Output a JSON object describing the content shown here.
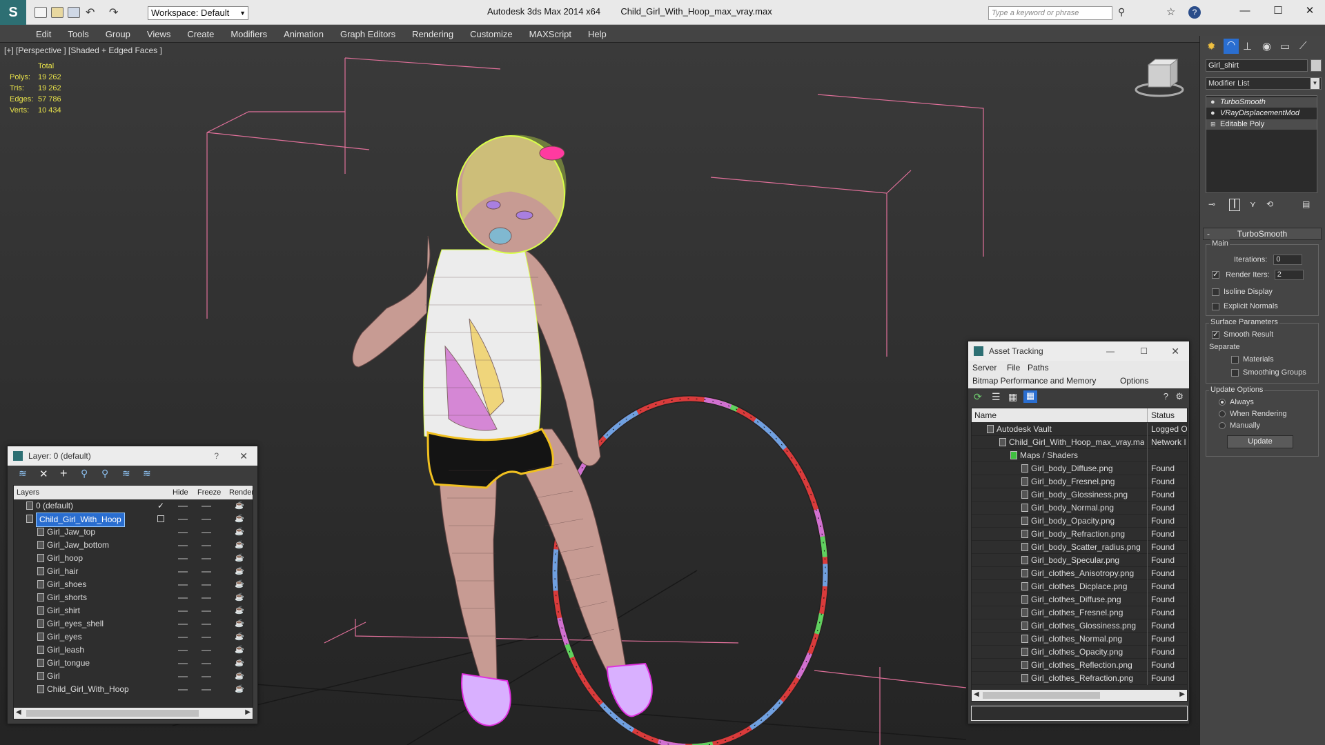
{
  "titlebar": {
    "app_title": "Autodesk 3ds Max  2014 x64",
    "file_name": "Child_Girl_With_Hoop_max_vray.max",
    "workspace_label": "Workspace: Default",
    "search_placeholder": "Type a keyword or phrase"
  },
  "menu": [
    "Edit",
    "Tools",
    "Group",
    "Views",
    "Create",
    "Modifiers",
    "Animation",
    "Graph Editors",
    "Rendering",
    "Customize",
    "MAXScript",
    "Help"
  ],
  "viewport": {
    "label": "[+] [Perspective ] [Shaded + Edged Faces ]",
    "stats": {
      "header": "Total",
      "rows": [
        {
          "label": "Polys:",
          "value": "19 262"
        },
        {
          "label": "Tris:",
          "value": "19 262"
        },
        {
          "label": "Edges:",
          "value": "57 786"
        },
        {
          "label": "Verts:",
          "value": "10 434"
        }
      ]
    },
    "colors": {
      "selection": "#d9ff4a",
      "box": "#e0709a",
      "hoop_red": "#e03030"
    }
  },
  "command_panel": {
    "object_name": "Girl_shirt",
    "modifier_list": "Modifier List",
    "stack": [
      {
        "label": "TurboSmooth",
        "italic": true
      },
      {
        "label": "VRayDisplacementMod",
        "italic": true
      },
      {
        "label": "Editable Poly",
        "italic": false
      }
    ],
    "turbosmooth": {
      "header": "TurboSmooth",
      "main_label": "Main",
      "iterations_label": "Iterations:",
      "iterations_value": "0",
      "render_iters_label": "Render Iters:",
      "render_iters_value": "2",
      "isoline": "Isoline Display",
      "explicit_normals": "Explicit Normals",
      "surface_params": "Surface Parameters",
      "smooth_result": "Smooth Result",
      "separate": "Separate",
      "materials": "Materials",
      "smoothing_groups": "Smoothing Groups",
      "update_options": "Update Options",
      "always": "Always",
      "when_rendering": "When Rendering",
      "manually": "Manually",
      "update_button": "Update"
    }
  },
  "layer_window": {
    "title": "Layer: 0 (default)",
    "columns": {
      "layers": "Layers",
      "hide": "Hide",
      "freeze": "Freeze",
      "render": "Render"
    },
    "rows": [
      {
        "name": "0 (default)",
        "indent": 1,
        "state": "check"
      },
      {
        "name": "Child_Girl_With_Hoop",
        "indent": 1,
        "state": "box",
        "selected": true
      },
      {
        "name": "Girl_Jaw_top",
        "indent": 2
      },
      {
        "name": "Girl_Jaw_bottom",
        "indent": 2
      },
      {
        "name": "Girl_hoop",
        "indent": 2
      },
      {
        "name": "Girl_hair",
        "indent": 2
      },
      {
        "name": "Girl_shoes",
        "indent": 2
      },
      {
        "name": "Girl_shorts",
        "indent": 2
      },
      {
        "name": "Girl_shirt",
        "indent": 2
      },
      {
        "name": "Girl_eyes_shell",
        "indent": 2
      },
      {
        "name": "Girl_eyes",
        "indent": 2
      },
      {
        "name": "Girl_leash",
        "indent": 2
      },
      {
        "name": "Girl_tongue",
        "indent": 2
      },
      {
        "name": "Girl",
        "indent": 2
      },
      {
        "name": "Child_Girl_With_Hoop",
        "indent": 2
      }
    ]
  },
  "asset_window": {
    "title": "Asset Tracking",
    "menu": [
      "Server",
      "File",
      "Paths",
      "Bitmap Performance and Memory",
      "Options"
    ],
    "columns": {
      "name": "Name",
      "status": "Status"
    },
    "rows": [
      {
        "name": "Autodesk Vault",
        "status": "Logged O",
        "indent": 1
      },
      {
        "name": "Child_Girl_With_Hoop_max_vray.max",
        "status": "Network I",
        "indent": 2
      },
      {
        "name": "Maps / Shaders",
        "status": "",
        "indent": 3
      },
      {
        "name": "Girl_body_Diffuse.png",
        "status": "Found",
        "indent": 4
      },
      {
        "name": "Girl_body_Fresnel.png",
        "status": "Found",
        "indent": 4
      },
      {
        "name": "Girl_body_Glossiness.png",
        "status": "Found",
        "indent": 4
      },
      {
        "name": "Girl_body_Normal.png",
        "status": "Found",
        "indent": 4
      },
      {
        "name": "Girl_body_Opacity.png",
        "status": "Found",
        "indent": 4
      },
      {
        "name": "Girl_body_Refraction.png",
        "status": "Found",
        "indent": 4
      },
      {
        "name": "Girl_body_Scatter_radius.png",
        "status": "Found",
        "indent": 4
      },
      {
        "name": "Girl_body_Specular.png",
        "status": "Found",
        "indent": 4
      },
      {
        "name": "Girl_clothes_Anisotropy.png",
        "status": "Found",
        "indent": 4
      },
      {
        "name": "Girl_clothes_Dicplace.png",
        "status": "Found",
        "indent": 4
      },
      {
        "name": "Girl_clothes_Diffuse.png",
        "status": "Found",
        "indent": 4
      },
      {
        "name": "Girl_clothes_Fresnel.png",
        "status": "Found",
        "indent": 4
      },
      {
        "name": "Girl_clothes_Glossiness.png",
        "status": "Found",
        "indent": 4
      },
      {
        "name": "Girl_clothes_Normal.png",
        "status": "Found",
        "indent": 4
      },
      {
        "name": "Girl_clothes_Opacity.png",
        "status": "Found",
        "indent": 4
      },
      {
        "name": "Girl_clothes_Reflection.png",
        "status": "Found",
        "indent": 4
      },
      {
        "name": "Girl_clothes_Refraction.png",
        "status": "Found",
        "indent": 4
      }
    ]
  }
}
